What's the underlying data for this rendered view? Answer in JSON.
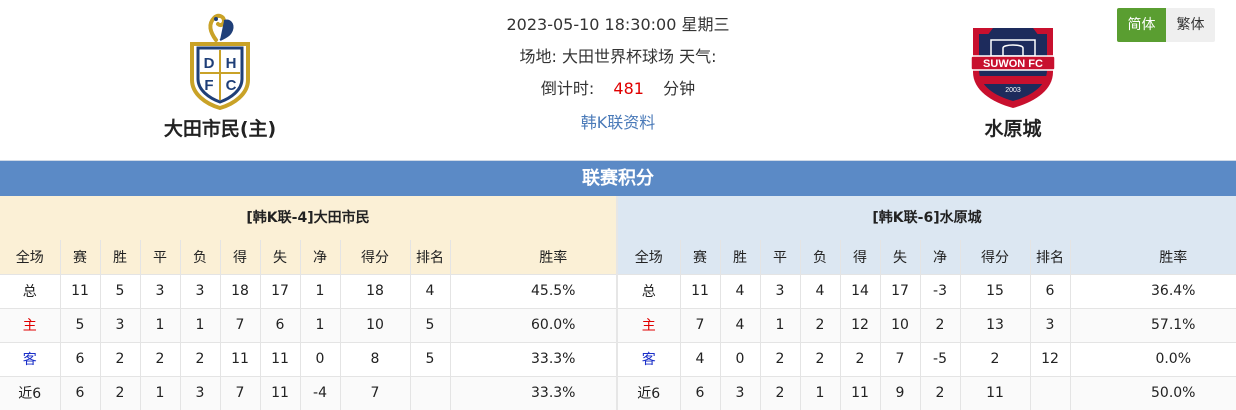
{
  "match": {
    "datetime": "2023-05-10 18:30:00 星期三",
    "venue_label": "场地:",
    "venue": "大田世界杯球场",
    "weather_label": "天气:",
    "weather": "",
    "countdown_label": "倒计时:",
    "countdown_value": "481",
    "countdown_unit": "分钟",
    "league_link": "韩K联资料"
  },
  "home_team": {
    "name": "大田市民(主)",
    "logo_letters": [
      "D",
      "H",
      "F",
      "C"
    ]
  },
  "away_team": {
    "name": "水原城",
    "logo_text": "SUWON FC",
    "logo_year": "2003"
  },
  "lang": {
    "simplified": "简体",
    "traditional": "繁体"
  },
  "standings": {
    "title": "联赛积分",
    "columns": [
      "全场",
      "赛",
      "胜",
      "平",
      "负",
      "得",
      "失",
      "净",
      "得分",
      "排名",
      "胜率"
    ],
    "home": {
      "title": "[韩K联-4]大田市民",
      "rows": [
        [
          "总",
          "11",
          "5",
          "3",
          "3",
          "18",
          "17",
          "1",
          "18",
          "4",
          "45.5%"
        ],
        [
          "主",
          "5",
          "3",
          "1",
          "1",
          "7",
          "6",
          "1",
          "10",
          "5",
          "60.0%"
        ],
        [
          "客",
          "6",
          "2",
          "2",
          "2",
          "11",
          "11",
          "0",
          "8",
          "5",
          "33.3%"
        ],
        [
          "近6",
          "6",
          "2",
          "1",
          "3",
          "7",
          "11",
          "-4",
          "7",
          "",
          "33.3%"
        ]
      ]
    },
    "away": {
      "title": "[韩K联-6]水原城",
      "rows": [
        [
          "总",
          "11",
          "4",
          "3",
          "4",
          "14",
          "17",
          "-3",
          "15",
          "6",
          "36.4%"
        ],
        [
          "主",
          "7",
          "4",
          "1",
          "2",
          "12",
          "10",
          "2",
          "13",
          "3",
          "57.1%"
        ],
        [
          "客",
          "4",
          "0",
          "2",
          "2",
          "2",
          "7",
          "-5",
          "2",
          "12",
          "0.0%"
        ],
        [
          "近6",
          "6",
          "3",
          "2",
          "1",
          "11",
          "9",
          "2",
          "11",
          "",
          "50.0%"
        ]
      ]
    }
  },
  "colors": {
    "section_bar": "#5b8ac6",
    "home_panel": "#fbf0d6",
    "away_panel": "#dce7f2",
    "active_lang": "#5a9e31",
    "countdown": "#e00000",
    "link": "#4a7ab8",
    "home_label": "#e00000",
    "away_label": "#1a2fc8"
  }
}
